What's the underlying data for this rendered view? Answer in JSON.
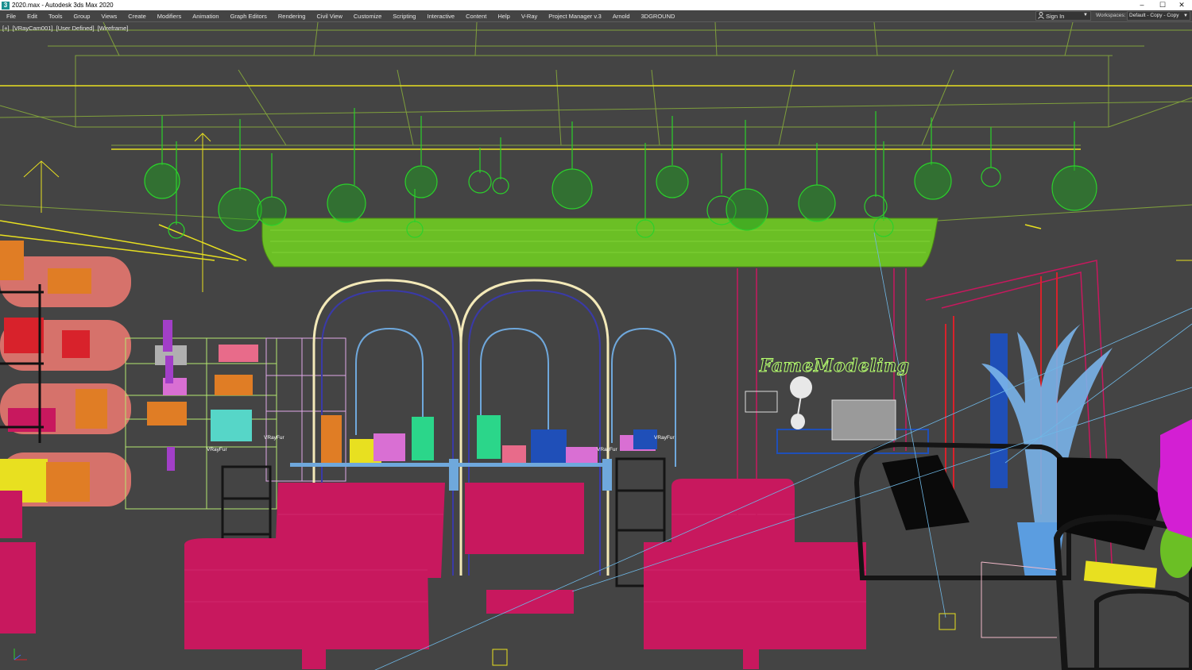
{
  "window": {
    "title": "2020.max - Autodesk 3ds Max 2020",
    "app_icon": "3"
  },
  "window_controls": {
    "minimize": "–",
    "maximize": "☐",
    "close": "✕"
  },
  "menu": {
    "items": [
      "File",
      "Edit",
      "Tools",
      "Group",
      "Views",
      "Create",
      "Modifiers",
      "Animation",
      "Graph Editors",
      "Rendering",
      "Civil View",
      "Customize",
      "Scripting",
      "Interactive",
      "Content",
      "Help",
      "V-Ray",
      "Project Manager v.3",
      "Arnold",
      "3DGROUND"
    ],
    "sign_in": "Sign In",
    "workspaces_label": "Workspaces:",
    "workspace_value": "Default - Copy - Copy"
  },
  "viewport": {
    "label_parts": [
      "[+]",
      "[VRayCam001]",
      "[User Defined]",
      "[Wireframe]"
    ],
    "vray_fur_labels": [
      "VRayFur",
      "VRayFur",
      "VRayFur",
      "VRayFur"
    ],
    "brand_text": "FameModeling"
  },
  "colors": {
    "ceiling_green": "#6bbf25",
    "pendant_green": "#2bd12b",
    "chair_magenta": "#c8185e",
    "shelf_salmon": "#f07a72",
    "arch_cream": "#f3e9b8",
    "arch_blue": "#6fa8dc",
    "plant_blue": "#7ab4ea",
    "orange": "#e07d25",
    "yellow": "#e8e020"
  }
}
